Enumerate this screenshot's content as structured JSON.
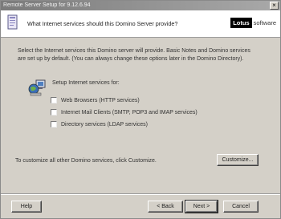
{
  "window": {
    "title": "Remote Server Setup for 9.12.6.94",
    "close_glyph": "×"
  },
  "banner": {
    "question": "What Internet services should this Domino Server provide?",
    "brand_box": "Lotus",
    "brand_tail": "software"
  },
  "intro": "Select the Internet services this Domino server will provide. Basic Notes and Domino services are set up by default. (You can always change these options later in the Domino Directory).",
  "setup_label": "Setup Internet services for:",
  "options": [
    {
      "label": "Web Browsers (HTTP services)",
      "checked": false
    },
    {
      "label": "Internet Mail Clients (SMTP, POP3 and IMAP services)",
      "checked": false
    },
    {
      "label": "Directory services (LDAP services)",
      "checked": false
    }
  ],
  "customize_text": "To customize all other Domino services, click Customize.",
  "buttons": {
    "customize": "Customize...",
    "help": "Help",
    "back": "< Back",
    "next": "Next >",
    "cancel": "Cancel"
  },
  "icons": [
    "document-icon",
    "globe-network-icon"
  ]
}
